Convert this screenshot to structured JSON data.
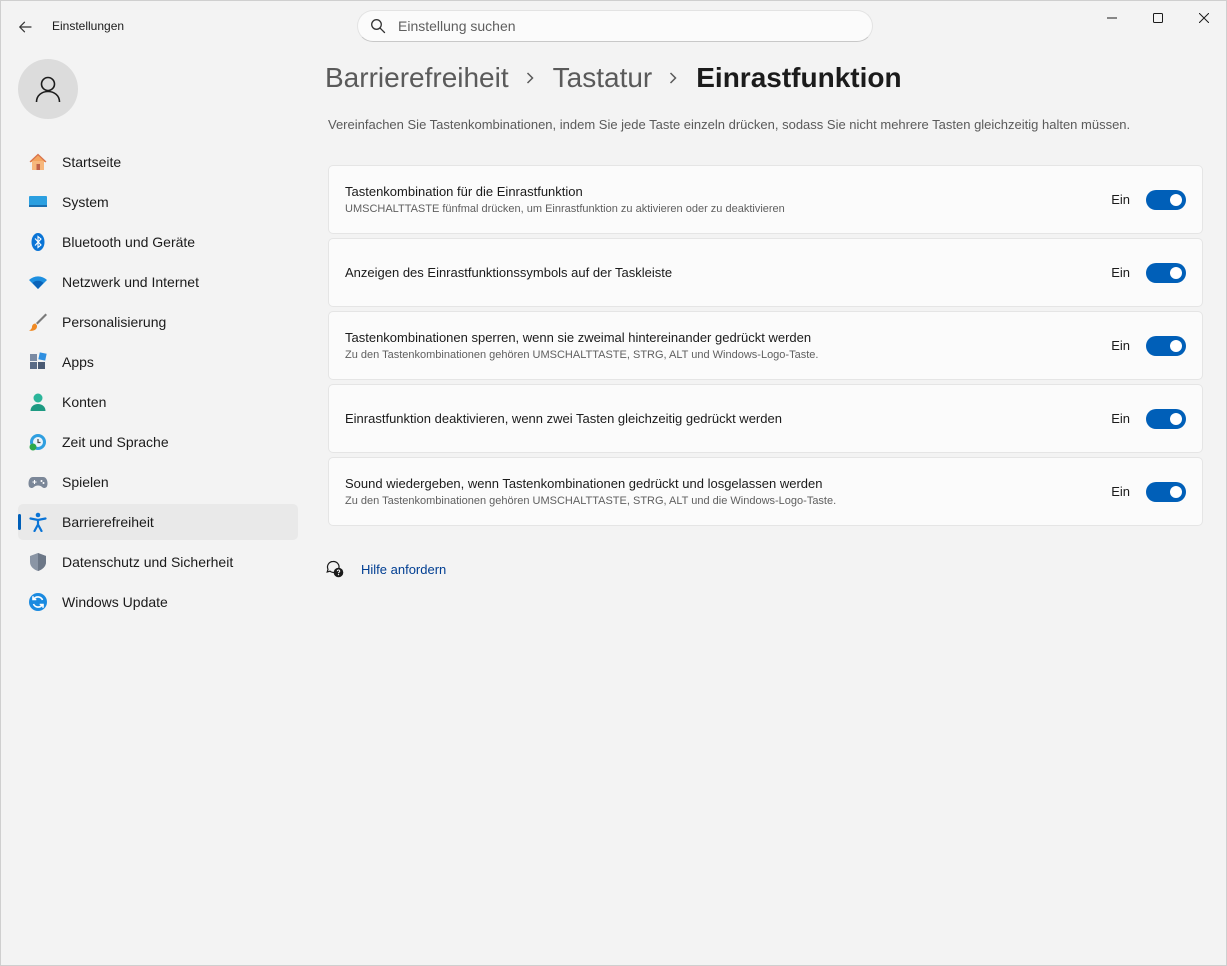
{
  "window": {
    "title": "Einstellungen"
  },
  "search": {
    "placeholder": "Einstellung suchen"
  },
  "sidebar": {
    "items": [
      {
        "label": "Startseite",
        "icon": "home-icon"
      },
      {
        "label": "System",
        "icon": "system-icon"
      },
      {
        "label": "Bluetooth und Geräte",
        "icon": "bluetooth-icon"
      },
      {
        "label": "Netzwerk und Internet",
        "icon": "wifi-icon"
      },
      {
        "label": "Personalisierung",
        "icon": "brush-icon"
      },
      {
        "label": "Apps",
        "icon": "apps-icon"
      },
      {
        "label": "Konten",
        "icon": "account-icon"
      },
      {
        "label": "Zeit und Sprache",
        "icon": "clock-globe-icon"
      },
      {
        "label": "Spielen",
        "icon": "gamepad-icon"
      },
      {
        "label": "Barrierefreiheit",
        "icon": "accessibility-icon",
        "active": true
      },
      {
        "label": "Datenschutz und Sicherheit",
        "icon": "shield-icon"
      },
      {
        "label": "Windows Update",
        "icon": "update-icon"
      }
    ]
  },
  "breadcrumb": [
    "Barrierefreiheit",
    "Tastatur",
    "Einrastfunktion"
  ],
  "main": {
    "description": "Vereinfachen Sie Tastenkombinationen, indem Sie jede Taste einzeln drücken, sodass Sie nicht mehrere Tasten gleichzeitig halten müssen.",
    "settings": [
      {
        "title": "Tastenkombination für die Einrastfunktion",
        "subtitle": "UMSCHALTTASTE fünfmal drücken, um Einrastfunktion zu aktivieren oder zu deaktivieren",
        "state": "Ein",
        "on": true
      },
      {
        "title": "Anzeigen des Einrastfunktionssymbols auf der Taskleiste",
        "subtitle": "",
        "state": "Ein",
        "on": true
      },
      {
        "title": "Tastenkombinationen sperren, wenn sie zweimal hintereinander gedrückt werden",
        "subtitle": "Zu den Tastenkombinationen gehören UMSCHALTTASTE, STRG, ALT und Windows-Logo-Taste.",
        "state": "Ein",
        "on": true
      },
      {
        "title": "Einrastfunktion deaktivieren, wenn zwei Tasten gleichzeitig gedrückt werden",
        "subtitle": "",
        "state": "Ein",
        "on": true
      },
      {
        "title": "Sound wiedergeben, wenn Tastenkombinationen gedrückt und losgelassen werden",
        "subtitle": "Zu den Tastenkombinationen gehören UMSCHALTTASTE, STRG, ALT und die Windows-Logo-Taste.",
        "state": "Ein",
        "on": true
      }
    ],
    "help_link": "Hilfe anfordern"
  },
  "colors": {
    "accent": "#005fb8",
    "link": "#003e92",
    "background": "#f3f3f3",
    "card": "#fbfbfb"
  }
}
